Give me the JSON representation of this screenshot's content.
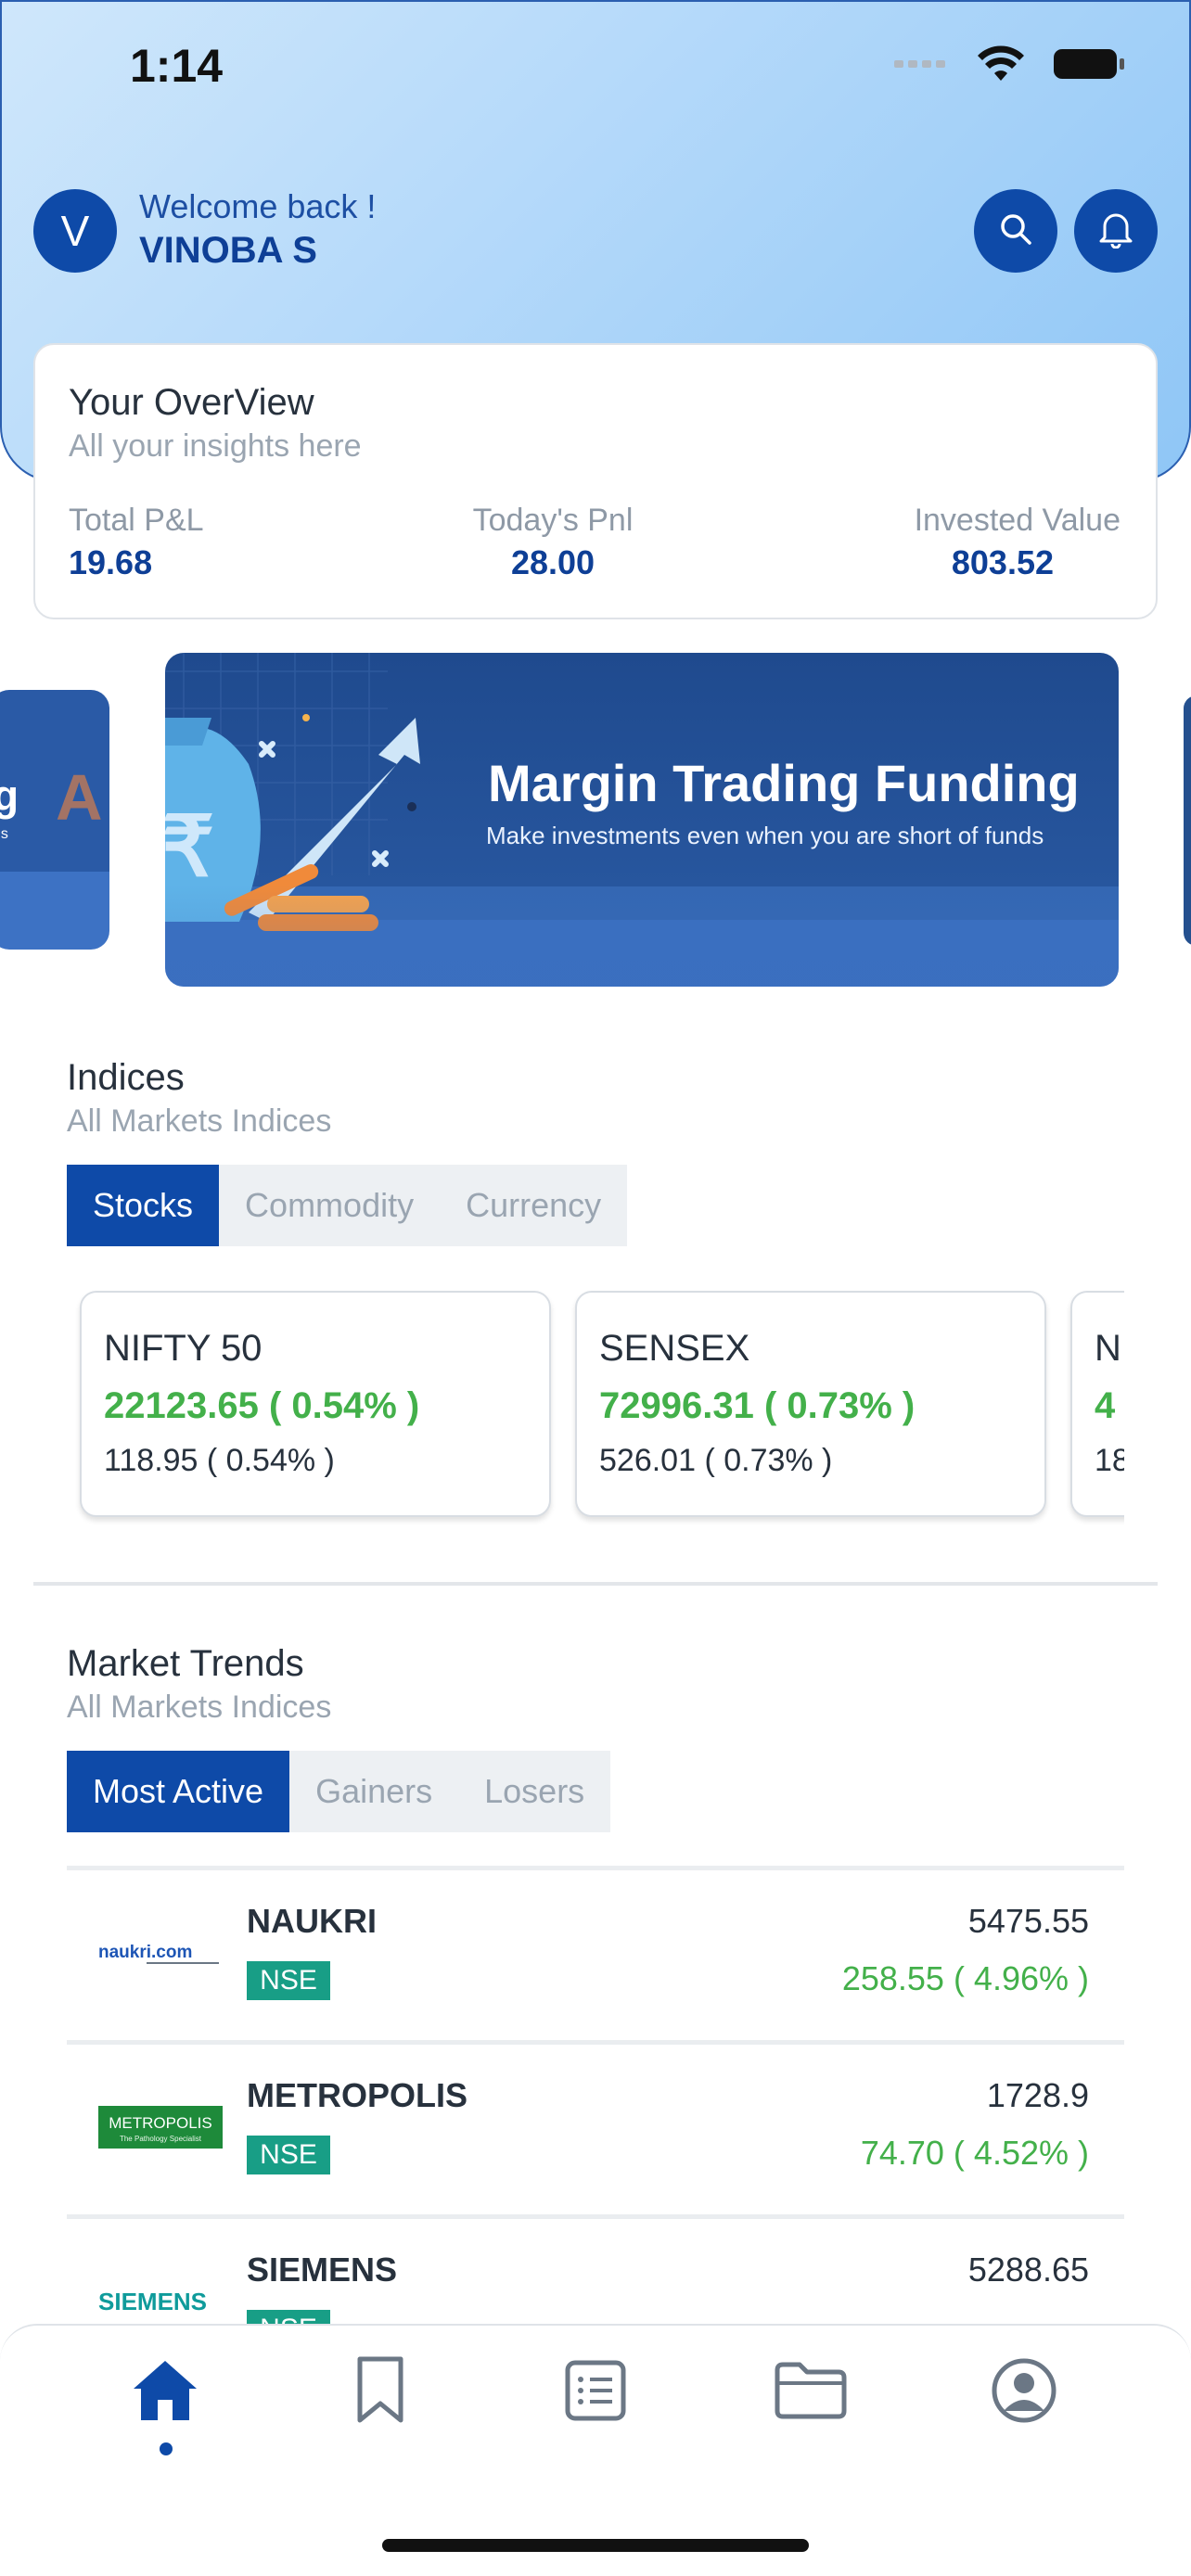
{
  "status_bar": {
    "time": "1:14"
  },
  "header": {
    "avatar_letter": "V",
    "welcome": "Welcome back !",
    "username": "VINOBA S"
  },
  "overview": {
    "title": "Your OverView",
    "subtitle": "All your insights here",
    "stats": [
      {
        "label": "Total P&L",
        "value": "19.68"
      },
      {
        "label": "Today's Pnl",
        "value": "28.00"
      },
      {
        "label": "Invested Value",
        "value": "803.52"
      }
    ]
  },
  "banner": {
    "title": "Margin Trading Funding",
    "subtitle": "Make investments even when you are short of funds"
  },
  "indices": {
    "title": "Indices",
    "subtitle": "All Markets Indices",
    "tabs": [
      "Stocks",
      "Commodity",
      "Currency"
    ],
    "cards": [
      {
        "name": "NIFTY 50",
        "value": "22123.65 ( 0.54% )",
        "change": "118.95 ( 0.54% )"
      },
      {
        "name": "SENSEX",
        "value": "72996.31 ( 0.73% )",
        "change": "526.01 ( 0.73% )"
      },
      {
        "name": "N",
        "value": "4",
        "change": "18"
      }
    ]
  },
  "market_trends": {
    "title": "Market Trends",
    "subtitle": "All Markets Indices",
    "tabs": [
      "Most Active",
      "Gainers",
      "Losers"
    ],
    "stocks": [
      {
        "logo_text": "naukri.com",
        "name": "NAUKRI",
        "exchange": "NSE",
        "price": "5475.55",
        "change": "258.55 ( 4.96% )"
      },
      {
        "logo_text": "METROPOLIS",
        "logo_sub": "The Pathology Specialist",
        "name": "METROPOLIS",
        "exchange": "NSE",
        "price": "1728.9",
        "change": "74.70 ( 4.52% )"
      },
      {
        "logo_text": "SIEMENS",
        "name": "SIEMENS",
        "exchange": "NSE",
        "price": "5288.65",
        "change": ""
      }
    ]
  },
  "colors": {
    "primary": "#0e4aa8",
    "positive": "#43b04a",
    "nse_badge": "#189e86"
  },
  "bottom_nav": [
    "home-icon",
    "bookmark-icon",
    "orders-list-icon",
    "folder-icon",
    "profile-icon"
  ]
}
